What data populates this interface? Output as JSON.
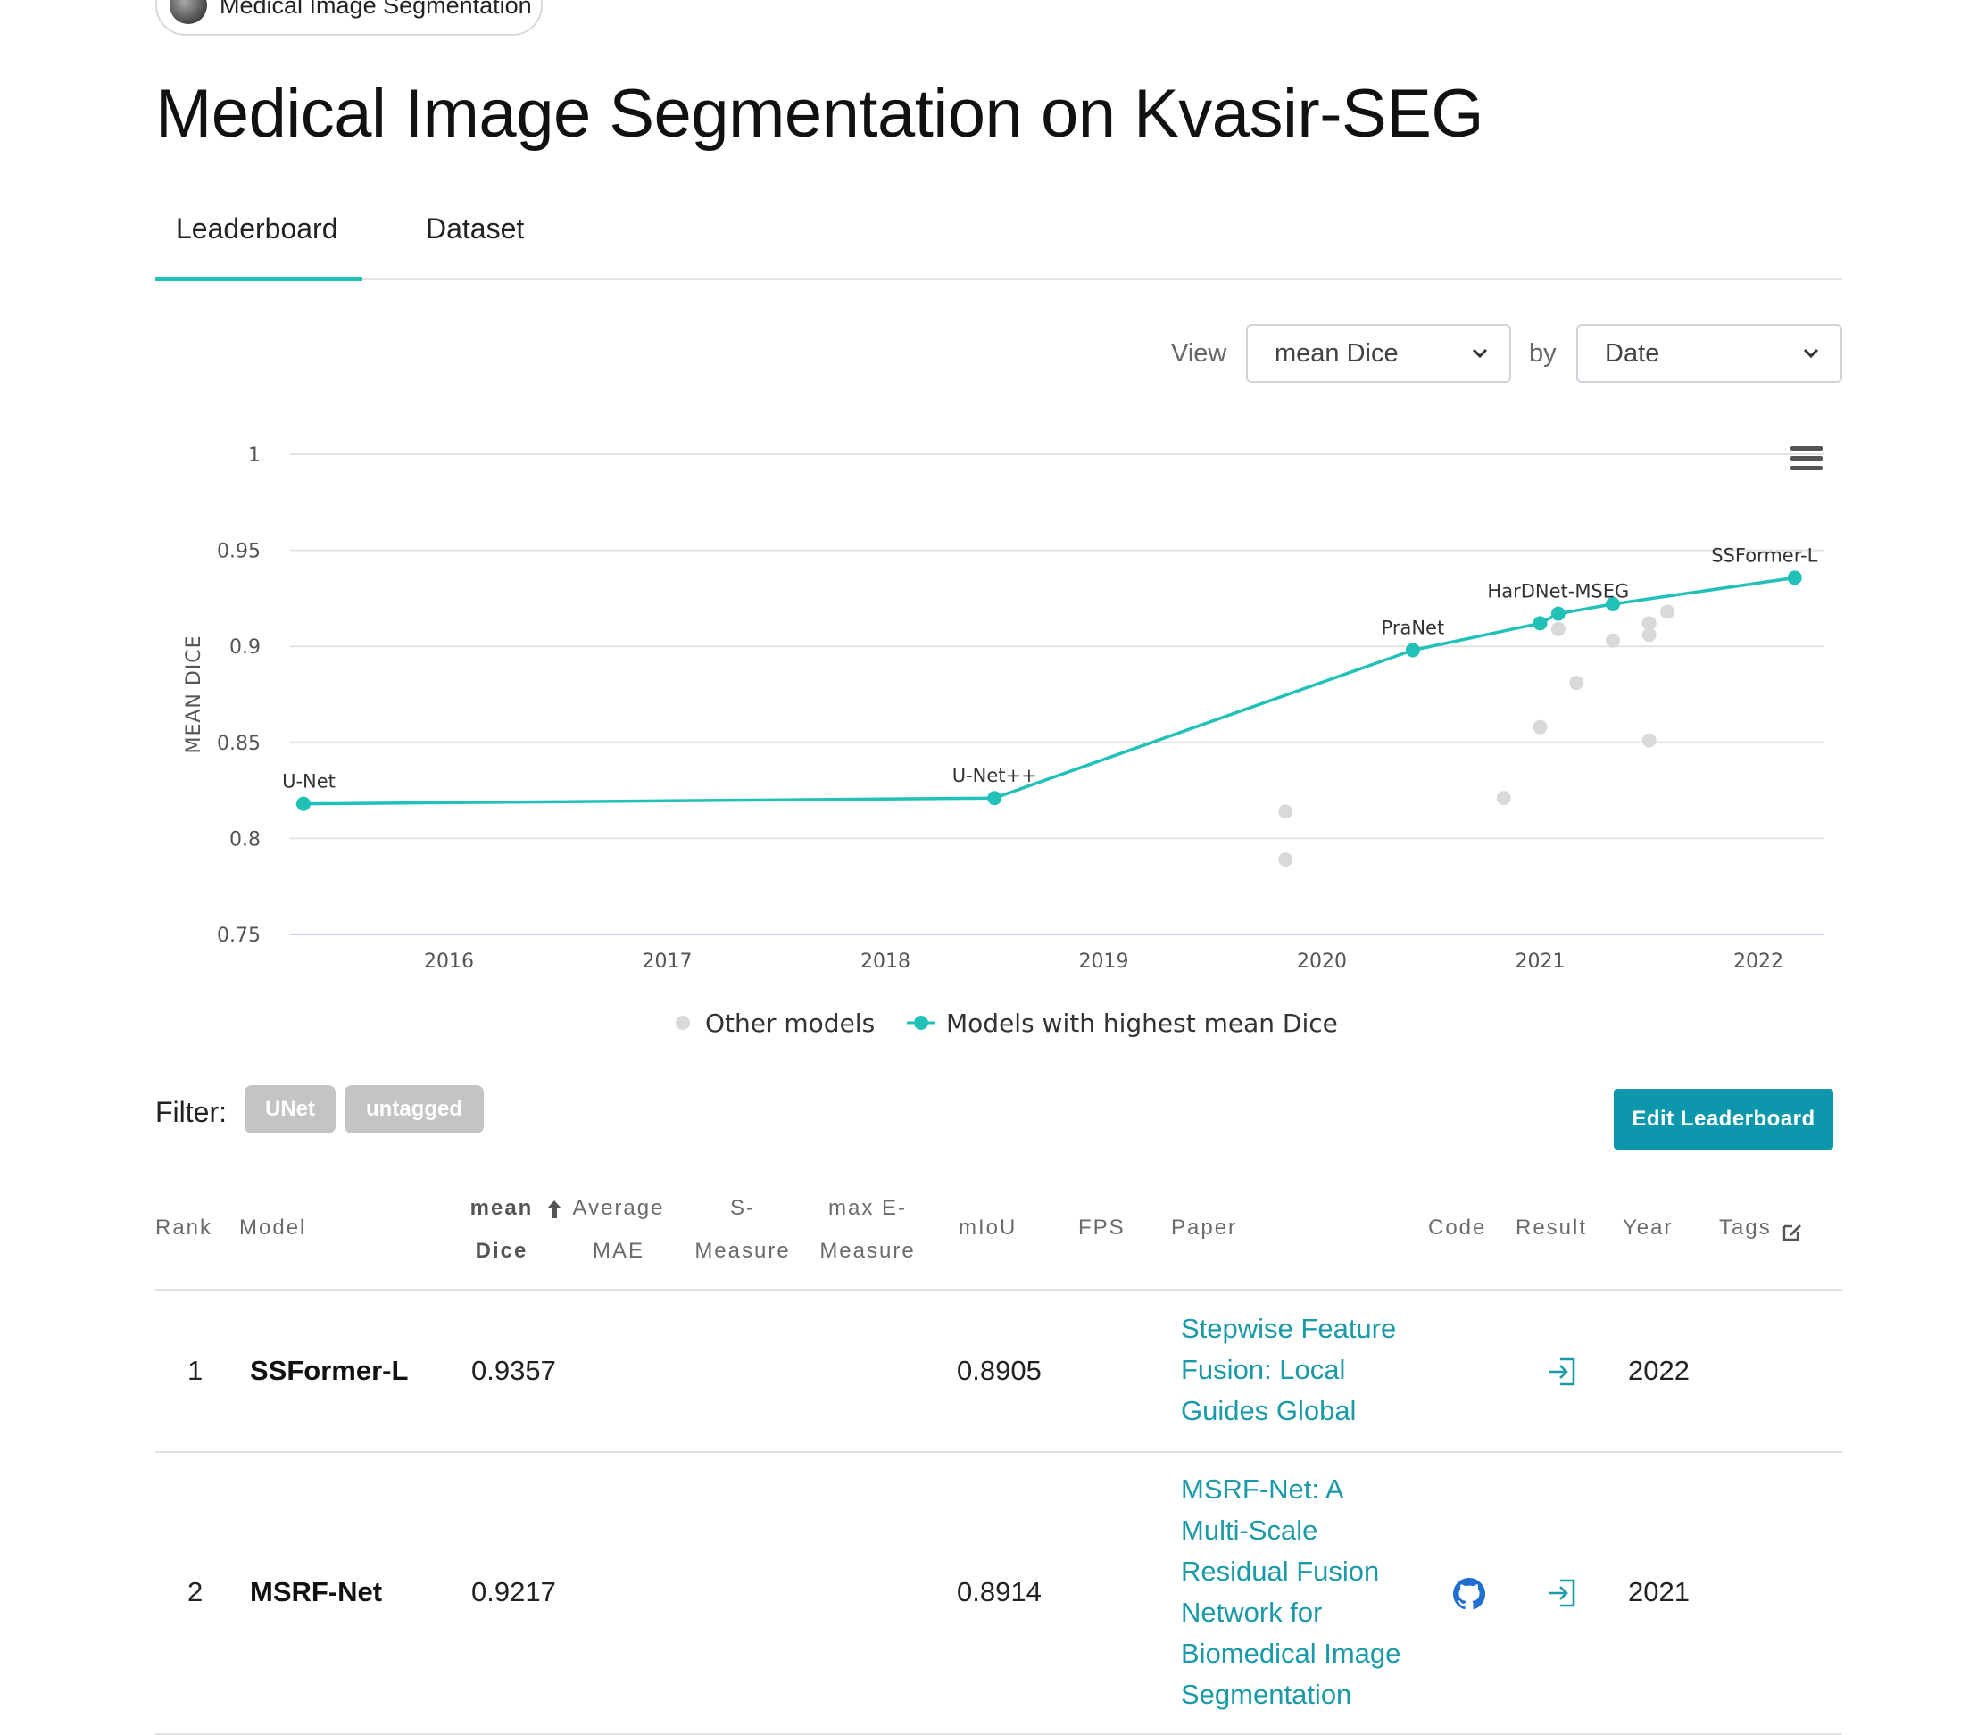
{
  "breadcrumb": {
    "label": "Medical Image Segmentation"
  },
  "page": {
    "title": "Medical Image Segmentation on Kvasir-SEG"
  },
  "tabs": [
    {
      "label": "Leaderboard",
      "active": true
    },
    {
      "label": "Dataset",
      "active": false
    }
  ],
  "controls": {
    "view_label": "View",
    "view_value": "mean Dice",
    "by_label": "by",
    "by_value": "Date"
  },
  "chart_data": {
    "type": "scatter",
    "ylabel": "MEAN DICE",
    "xlabel": "",
    "ylim": [
      0.75,
      1
    ],
    "y_ticks": [
      "0.75",
      "0.8",
      "0.85",
      "0.9",
      "0.95",
      "1"
    ],
    "x_ticks": [
      "2016",
      "2017",
      "2018",
      "2019",
      "2020",
      "2021",
      "2022"
    ],
    "grid": true,
    "legend_position": "bottom",
    "series": [
      {
        "name": "Other models",
        "color": "#d9d9d9",
        "points": [
          {
            "x": "2019-11",
            "y": 0.814
          },
          {
            "x": "2019-11",
            "y": 0.789
          },
          {
            "x": "2020-11",
            "y": 0.821
          },
          {
            "x": "2021-01",
            "y": 0.858
          },
          {
            "x": "2021-02",
            "y": 0.909
          },
          {
            "x": "2021-03",
            "y": 0.881
          },
          {
            "x": "2021-05",
            "y": 0.903
          },
          {
            "x": "2021-07",
            "y": 0.912
          },
          {
            "x": "2021-07",
            "y": 0.906
          },
          {
            "x": "2021-07",
            "y": 0.851
          },
          {
            "x": "2021-08",
            "y": 0.918
          }
        ]
      },
      {
        "name": "Models with highest mean Dice",
        "color": "#21c1b8",
        "points": [
          {
            "x": "2015-05",
            "y": 0.818,
            "label": "U-Net"
          },
          {
            "x": "2018-07",
            "y": 0.821,
            "label": "U-Net++"
          },
          {
            "x": "2020-06",
            "y": 0.898,
            "label": "PraNet"
          },
          {
            "x": "2021-01",
            "y": 0.912,
            "label": ""
          },
          {
            "x": "2021-02",
            "y": 0.917,
            "label": "HarDNet-MSEG"
          },
          {
            "x": "2021-05",
            "y": 0.922,
            "label": ""
          },
          {
            "x": "2022-03",
            "y": 0.9357,
            "label": "SSFormer-L"
          }
        ]
      }
    ]
  },
  "filter": {
    "label": "Filter:",
    "tags": [
      "UNet",
      "untagged"
    ]
  },
  "edit_button": {
    "label": "Edit Leaderboard"
  },
  "table": {
    "headers": {
      "rank": "Rank",
      "model": "Model",
      "mean_dice_1": "mean",
      "mean_dice_2": "Dice",
      "avg_mae_1": "Average",
      "avg_mae_2": "MAE",
      "s_measure_1": "S-",
      "s_measure_2": "Measure",
      "max_e_1": "max E-",
      "max_e_2": "Measure",
      "miou": "mIoU",
      "fps": "FPS",
      "paper": "Paper",
      "code": "Code",
      "result": "Result",
      "year": "Year",
      "tags": "Tags"
    },
    "rows": [
      {
        "rank": "1",
        "model": "SSFormer-L",
        "mean_dice": "0.9357",
        "miou": "0.8905",
        "paper_lines": [
          "Stepwise Feature",
          "Fusion: Local",
          "Guides Global"
        ],
        "has_code": false,
        "year": "2022"
      },
      {
        "rank": "2",
        "model": "MSRF-Net",
        "mean_dice": "0.9217",
        "miou": "0.8914",
        "paper_lines": [
          "MSRF-Net: A",
          "Multi-Scale",
          "Residual Fusion",
          "Network for",
          "Biomedical Image",
          "Segmentation"
        ],
        "has_code": true,
        "year": "2021"
      }
    ]
  }
}
